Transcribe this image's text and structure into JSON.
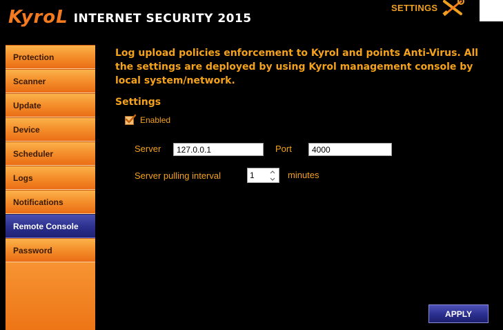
{
  "header": {
    "brand_logo": "KyroL",
    "product_name": "INTERNET SECURITY 2015",
    "settings_label": "SETTINGS",
    "settings_icon": "wrench-screwdriver-icon"
  },
  "sidebar": {
    "items": [
      {
        "label": "Protection",
        "active": false
      },
      {
        "label": "Scanner",
        "active": false
      },
      {
        "label": "Update",
        "active": false
      },
      {
        "label": "Device",
        "active": false
      },
      {
        "label": "Scheduler",
        "active": false
      },
      {
        "label": "Logs",
        "active": false
      },
      {
        "label": "Notifications",
        "active": false
      },
      {
        "label": "Remote Console",
        "active": true
      },
      {
        "label": "Password",
        "active": false
      }
    ]
  },
  "main": {
    "description": "Log upload policies enforcement to Kyrol and points Anti-Virus. All the settings are deployed by using Kyrol management console by local system/network.",
    "section_title": "Settings",
    "enabled": {
      "label": "Enabled",
      "checked": true
    },
    "server": {
      "label": "Server",
      "value": "127.0.0.1"
    },
    "port": {
      "label": "Port",
      "value": "4000"
    },
    "interval": {
      "label": "Server pulling interval",
      "value": "1",
      "unit": "minutes"
    },
    "apply_label": "APPLY"
  },
  "colors": {
    "background": "#000000",
    "accent_orange": "#f4a21c",
    "brand_orange": "#f47a20",
    "nav_active_blue": "#2b2f8c",
    "apply_blue": "#2a2e8e"
  }
}
